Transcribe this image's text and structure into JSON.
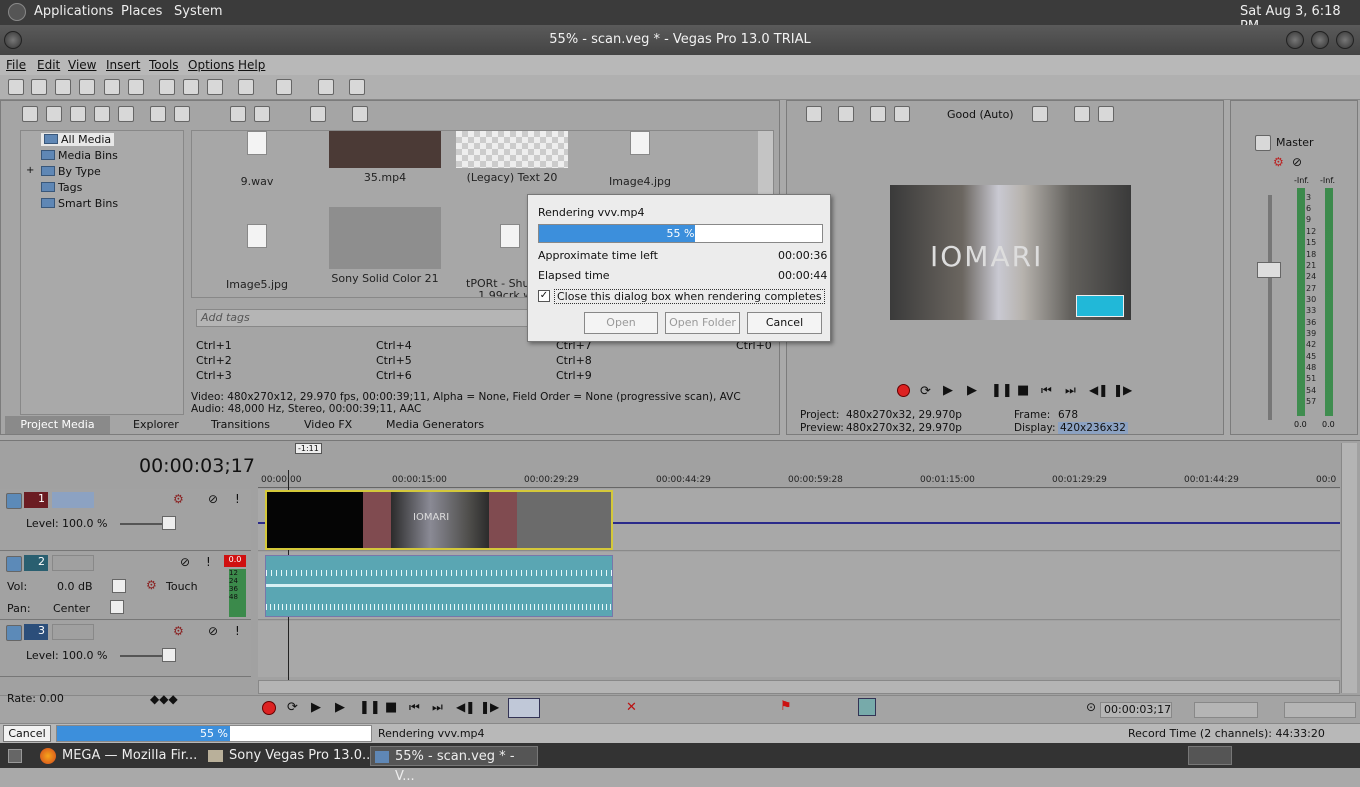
{
  "desktop": {
    "applications": "Applications",
    "places": "Places",
    "system": "System",
    "clock": "Sat Aug  3,  6:18 PM"
  },
  "window": {
    "title": "55% - scan.veg * - Vegas Pro 13.0 TRIAL"
  },
  "menu": [
    "File",
    "Edit",
    "View",
    "Insert",
    "Tools",
    "Options",
    "Help"
  ],
  "media_tree": [
    "All Media",
    "Media Bins",
    "By Type",
    "Tags",
    "Smart Bins"
  ],
  "media_items": [
    {
      "name": "9.wav"
    },
    {
      "name": "35.mp4"
    },
    {
      "name": "(Legacy) Text 20"
    },
    {
      "name": "Image4.jpg"
    },
    {
      "name": "Image5.jpg"
    },
    {
      "name": "Sony Solid Color 21"
    },
    {
      "name": "tPORt - Shurik... 1.99crk.w..."
    }
  ],
  "tags_placeholder": "Add tags",
  "shortcuts": [
    "Ctrl+1",
    "Ctrl+2",
    "Ctrl+3",
    "Ctrl+4",
    "Ctrl+5",
    "Ctrl+6",
    "Ctrl+7",
    "Ctrl+8",
    "Ctrl+9",
    "Ctrl+0"
  ],
  "media_info": {
    "video": "Video: 480x270x12, 29.970 fps, 00:00:39;11, Alpha = None, Field Order = None (progressive scan), AVC",
    "audio": "Audio: 48,000 Hz, Stereo, 00:00:39;11, AAC"
  },
  "panel_tabs": [
    "Project Media",
    "Explorer",
    "Transitions",
    "Video FX",
    "Media Generators"
  ],
  "preview": {
    "quality": "Good (Auto)",
    "project_label": "Project:",
    "project_value": "480x270x32, 29.970p",
    "preview_label": "Preview:",
    "preview_value": "480x270x32, 29.970p",
    "frame_label": "Frame:",
    "frame_value": "678",
    "display_label": "Display:",
    "display_value": "420x236x32"
  },
  "master": {
    "label": "Master",
    "left": "-Inf.",
    "right": "-Inf.",
    "scale": [
      "3",
      "6",
      "9",
      "12",
      "15",
      "18",
      "21",
      "24",
      "27",
      "30",
      "33",
      "36",
      "39",
      "42",
      "45",
      "48",
      "51",
      "54",
      "57"
    ],
    "bottom_left": "0.0",
    "bottom_right": "0.0"
  },
  "render_dialog": {
    "title": "Rendering vvv.mp4",
    "progress": 55,
    "progress_text": "55 %",
    "approx_label": "Approximate time left",
    "approx_value": "00:00:36",
    "elapsed_label": "Elapsed time",
    "elapsed_value": "00:00:44",
    "checkbox_label": "Close this dialog box when rendering completes",
    "open": "Open",
    "open_folder": "Open Folder",
    "cancel": "Cancel"
  },
  "timeline": {
    "timecode": "00:00:03;17",
    "marker": "-1:11",
    "ruler": [
      "00:00:00",
      "00:00:15:00",
      "00:00:29:29",
      "00:00:44:29",
      "00:00:59:28",
      "00:01:15:00",
      "00:01:29:29",
      "00:01:44:29",
      "00:0"
    ],
    "tracks": [
      {
        "num": "1",
        "level_label": "Level:",
        "level": "100.0 %"
      },
      {
        "num": "2",
        "vol_label": "Vol:",
        "vol": "0.0 dB",
        "pan_label": "Pan:",
        "pan": "Center",
        "mode": "Touch",
        "peak": "0.0",
        "meter": [
          "12",
          "24",
          "36",
          "48"
        ]
      },
      {
        "num": "3",
        "level_label": "Level:",
        "level": "100.0 %"
      }
    ],
    "clip_text": "IOMARI"
  },
  "transport": {
    "rate": "Rate: 0.00",
    "cursor_time": "00:00:03;17"
  },
  "status": {
    "cancel": "Cancel",
    "progress": 55,
    "progress_text": "55 %",
    "rendering": "Rendering vvv.mp4",
    "record_time": "Record Time (2 channels): 44:33:20"
  },
  "taskbar": [
    {
      "label": "MEGA — Mozilla Fir..."
    },
    {
      "label": "Sony Vegas Pro 13.0..."
    },
    {
      "label": "55% - scan.veg * - V..."
    }
  ]
}
